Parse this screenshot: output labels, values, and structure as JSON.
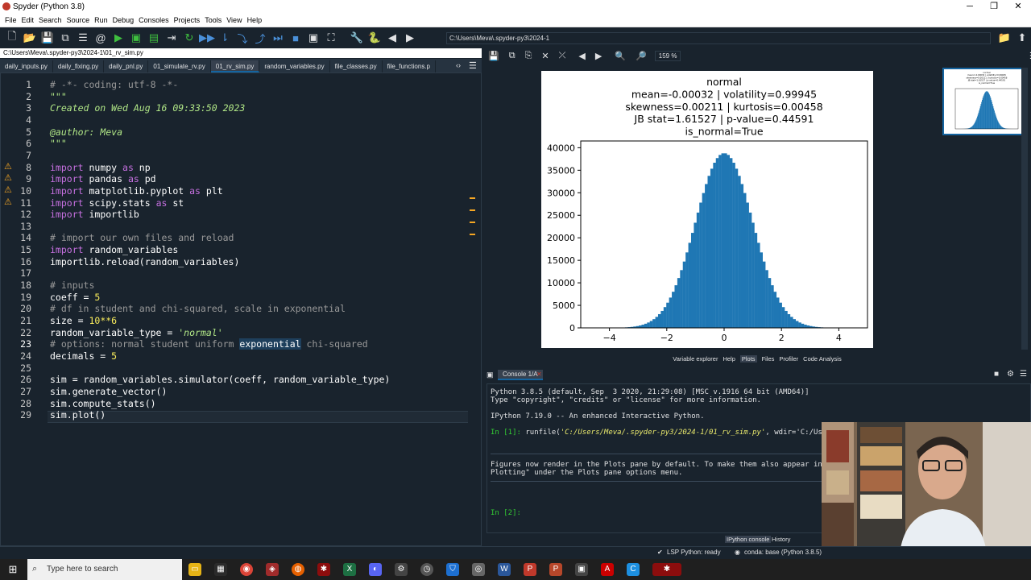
{
  "window": {
    "title": "Spyder (Python 3.8)"
  },
  "menu": [
    "File",
    "Edit",
    "Search",
    "Source",
    "Run",
    "Debug",
    "Consoles",
    "Projects",
    "Tools",
    "View",
    "Help"
  ],
  "toolbar": {
    "path": "C:\\Users\\Meva\\.spyder-py3\\2024-1"
  },
  "editor": {
    "filepath": "C:\\Users\\Meva\\.spyder-py3\\2024-1\\01_rv_sim.py",
    "tabs": [
      "daily_inputs.py",
      "daily_fixing.py",
      "daily_pnl.py",
      "01_simulate_rv.py",
      "01_rv_sim.py",
      "random_variables.py",
      "file_classes.py",
      "file_functions.p"
    ],
    "active_tab": 4,
    "lines": [
      "# -*- coding: utf-8 -*-",
      "\"\"\"",
      "Created on Wed Aug 16 09:33:50 2023",
      "",
      "@author: Meva",
      "\"\"\"",
      "",
      "import numpy as np",
      "import pandas as pd",
      "import matplotlib.pyplot as plt",
      "import scipy.stats as st",
      "import importlib",
      "",
      "# import our own files and reload",
      "import random_variables",
      "importlib.reload(random_variables)",
      "",
      "# inputs",
      "coeff = 5",
      "# df in student and chi-squared, scale in exponential",
      "size = 10**6",
      "random_variable_type = 'normal'",
      "# options: normal student uniform exponential chi-squared",
      "decimals = 5",
      "",
      "sim = random_variables.simulator(coeff, random_variable_type)",
      "sim.generate_vector()",
      "sim.compute_stats()",
      "sim.plot()"
    ],
    "line_numbers": [
      "1",
      "2",
      "3",
      "4",
      "5",
      "6",
      "7",
      "8",
      "9",
      "10",
      "11",
      "12",
      "13",
      "14",
      "15",
      "16",
      "17",
      "18",
      "19",
      "20",
      "21",
      "22",
      "23",
      "24",
      "25",
      "26",
      "27",
      "28",
      "29"
    ],
    "warning_lines": [
      8,
      9,
      10,
      11
    ],
    "current_line": 23
  },
  "plots": {
    "zoom": "159 %",
    "pane_tabs": [
      "Variable explorer",
      "Help",
      "Plots",
      "Files",
      "Profiler",
      "Code Analysis"
    ],
    "active_pane_tab": "Plots"
  },
  "chart_data": {
    "type": "bar",
    "title": "normal\nmean=-0.00032 | volatility=0.99945\nskewness=0.00211 | kurtosis=0.00458\nJB stat=1.61527 | p-value=0.44591\nis_normal=True",
    "title_lines": [
      "normal",
      "mean=-0.00032 | volatility=0.99945",
      "skewness=0.00211 | kurtosis=0.00458",
      "JB stat=1.61527 | p-value=0.44591",
      "is_normal=True"
    ],
    "xlim": [
      -5.0,
      5.0
    ],
    "ylim": [
      0,
      41500
    ],
    "xticks": [
      -4,
      -2,
      0,
      2,
      4
    ],
    "yticks": [
      0,
      5000,
      10000,
      15000,
      20000,
      25000,
      30000,
      35000,
      40000
    ],
    "bins": 100,
    "bin_range": [
      -4.8,
      4.8
    ],
    "peak_count": 38800,
    "bar_color": "#1f77b4"
  },
  "console": {
    "tab": "Console 1/A",
    "lines": [
      "Python 3.8.5 (default, Sep  3 2020, 21:29:08) [MSC v.1916 64 bit (AMD64)]",
      "Type \"copyright\", \"credits\" or \"license\" for more information.",
      "",
      "IPython 7.19.0 -- An enhanced Interactive Python."
    ],
    "in1_prompt": "In [1]:",
    "in1_cmd": "runfile(",
    "in1_path": "'C:/Users/Meva/.spyder-py3/2024-1/01_rv_sim.py'",
    "in1_rest": ", wdir='C:/Use",
    "info_lines": [
      "Figures now render in the Plots pane by default. To make them also appear inl",
      "Plotting\" under the Plots pane options menu."
    ],
    "in2_prompt": "In [2]:",
    "bottom_tabs": [
      "IPython console",
      "History"
    ]
  },
  "status": {
    "lsp": "LSP Python: ready",
    "conda": "conda: base (Python 3.8.5)"
  },
  "taskbar": {
    "search_placeholder": "Type here to search"
  }
}
